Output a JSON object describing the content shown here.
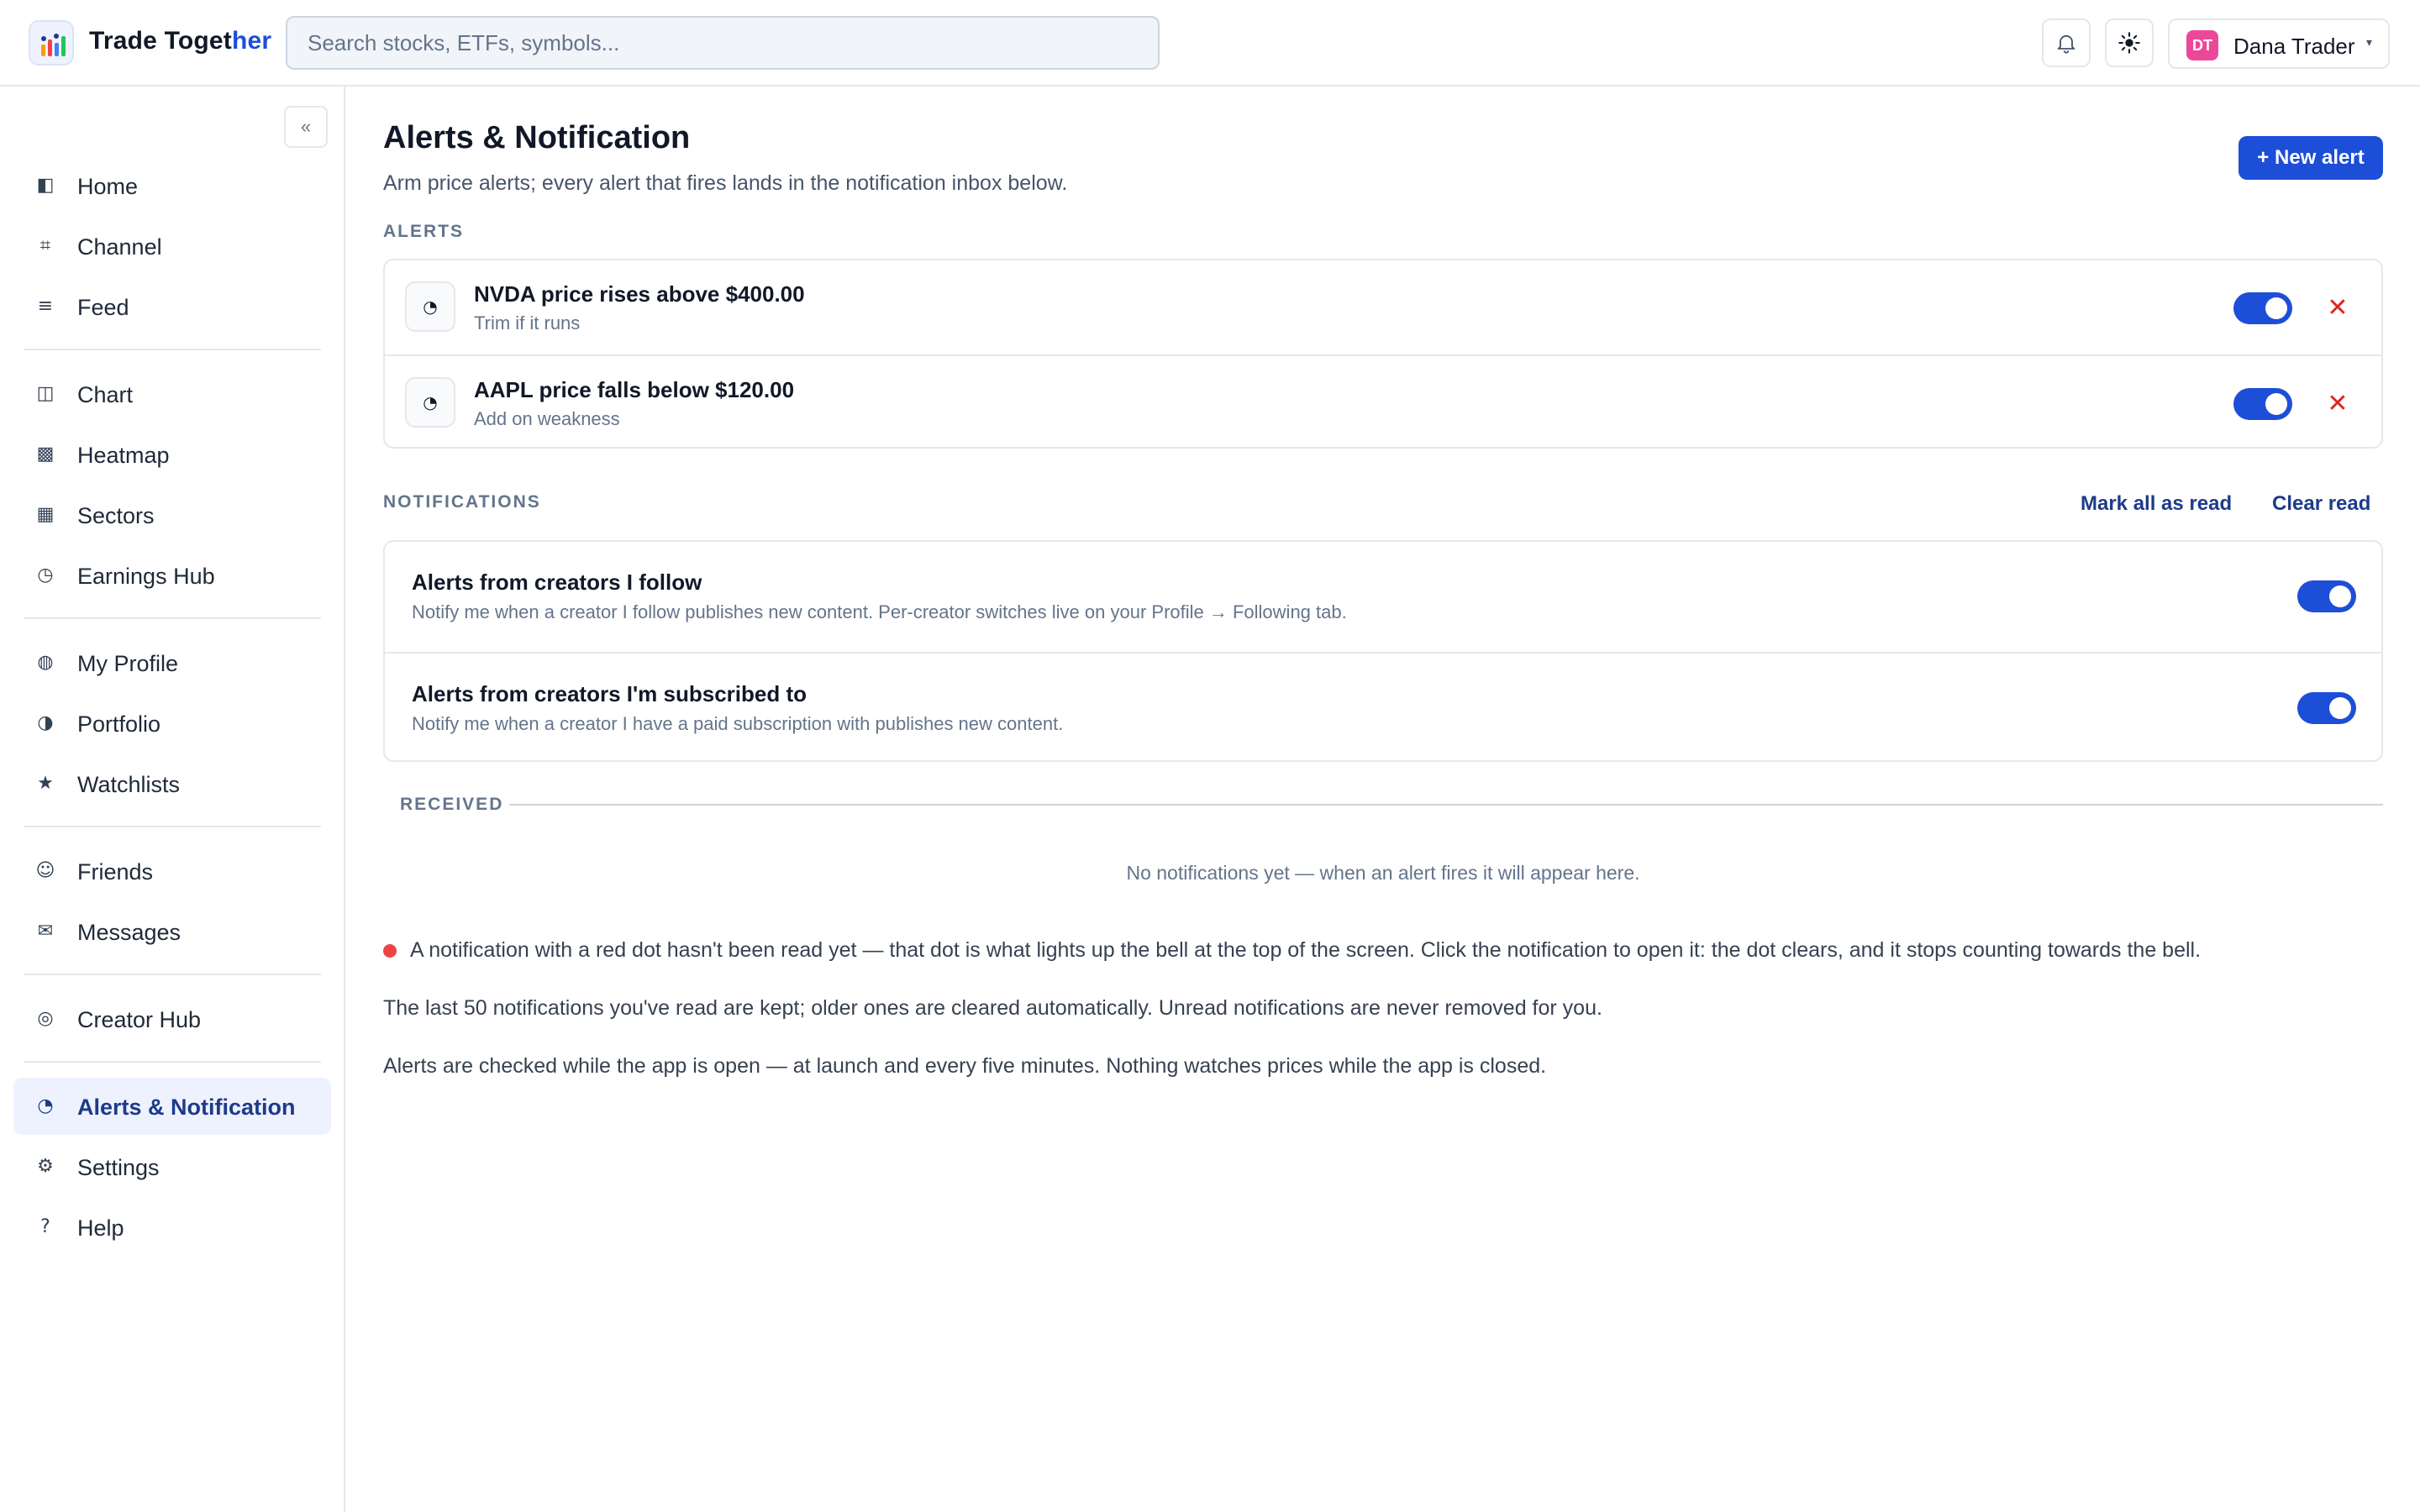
{
  "app": {
    "brand_main": "Trade Toget",
    "brand_accent": "her",
    "search_placeholder": "Search stocks, ETFs, symbols..."
  },
  "header": {
    "user_initials": "DT",
    "user_name": "Dana Trader",
    "caret": "▾",
    "bell_icon": "bell-icon",
    "theme_icon": "sun-icon"
  },
  "sidebar": {
    "collapse_label": "«",
    "items": [
      {
        "label": "Home",
        "icon": "◧"
      },
      {
        "label": "Channel",
        "icon": "⌗"
      },
      {
        "label": "Feed",
        "icon": "≡"
      },
      {
        "label": "Chart",
        "icon": "◫"
      },
      {
        "label": "Heatmap",
        "icon": "▩"
      },
      {
        "label": "Sectors",
        "icon": "▦"
      },
      {
        "label": "Earnings Hub",
        "icon": "◷"
      },
      {
        "label": "My Profile",
        "icon": "◍"
      },
      {
        "label": "Portfolio",
        "icon": "◑"
      },
      {
        "label": "Watchlists",
        "icon": "★"
      },
      {
        "label": "Friends",
        "icon": "☺"
      },
      {
        "label": "Messages",
        "icon": "✉"
      },
      {
        "label": "Creator Hub",
        "icon": "◎"
      },
      {
        "label": "Alerts & Notification",
        "icon": "◔"
      },
      {
        "label": "Settings",
        "icon": "⚙"
      },
      {
        "label": "Help",
        "icon": "?"
      }
    ]
  },
  "main": {
    "title": "Alerts & Notification",
    "subtitle": "Arm price alerts; every alert that fires lands in the notification inbox below.",
    "new_alert_label": "+ New alert",
    "alerts_label": "ALERTS",
    "alerts": [
      {
        "title": "NVDA price rises above $400.00",
        "note": "Trim if it runs",
        "icon": "◔",
        "enabled": true
      },
      {
        "title": "AAPL price falls below $120.00",
        "note": "Add on weakness",
        "icon": "◔",
        "enabled": true
      }
    ],
    "delete_glyph": "✕",
    "notifications_label": "NOTIFICATIONS",
    "mark_all_read": "Mark all as read",
    "clear_read": "Clear read",
    "settings": [
      {
        "title": "Alerts from creators I follow",
        "desc": "Notify me when a creator I follow publishes new content. Per-creator switches live on your Profile → Following tab.",
        "enabled": true
      },
      {
        "title": "Alerts from creators I'm subscribed to",
        "desc": "Notify me when a creator I have a paid subscription with publishes new content.",
        "enabled": true
      }
    ],
    "received_label": "RECEIVED",
    "empty_message": "No notifications yet — when an alert fires it will appear here.",
    "info": [
      "A notification with a red dot hasn't been read yet — that dot is what lights up the bell at the top of the screen. Click the notification to open it: the dot clears, and it stops counting towards the bell.",
      "The last 50 notifications you've read are kept; older ones are cleared automatically. Unread notifications are never removed for you.",
      "Alerts are checked while the app is open — at launch and every five minutes. Nothing watches prices while the app is closed."
    ]
  },
  "colors": {
    "accent": "#1d4ed8",
    "danger": "#dc2626",
    "unread_dot": "#ef4444",
    "active_nav_bg": "#eef2ff"
  }
}
